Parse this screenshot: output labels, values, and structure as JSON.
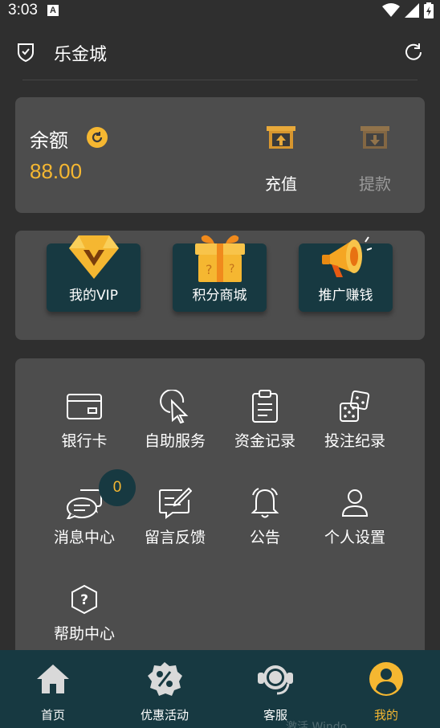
{
  "status_bar": {
    "time": "3:03",
    "notification_icon": "A"
  },
  "header": {
    "title": "乐金城"
  },
  "balance": {
    "label": "余额",
    "value": "88.00",
    "deposit_label": "充值",
    "withdraw_label": "提款"
  },
  "promos": [
    {
      "label": "我的VIP",
      "icon": "vip-diamond-icon"
    },
    {
      "label": "积分商城",
      "icon": "gift-box-icon"
    },
    {
      "label": "推广赚钱",
      "icon": "megaphone-icon"
    }
  ],
  "menu": [
    {
      "label": "银行卡",
      "icon": "bank-card-icon"
    },
    {
      "label": "自助服务",
      "icon": "pointer-hand-icon"
    },
    {
      "label": "资金记录",
      "icon": "clipboard-icon"
    },
    {
      "label": "投注纪录",
      "icon": "dice-icon"
    },
    {
      "label": "消息中心",
      "icon": "chat-bubbles-icon"
    },
    {
      "label": "留言反馈",
      "icon": "feedback-edit-icon"
    },
    {
      "label": "公告",
      "icon": "bell-icon"
    },
    {
      "label": "个人设置",
      "icon": "user-icon"
    },
    {
      "label": "帮助中心",
      "icon": "help-icon"
    }
  ],
  "message_badge": "0",
  "bottom_nav": [
    {
      "label": "首页",
      "icon": "home-icon"
    },
    {
      "label": "优惠活动",
      "icon": "percent-badge-icon"
    },
    {
      "label": "客服",
      "icon": "headset-icon"
    },
    {
      "label": "我的",
      "icon": "profile-icon"
    }
  ],
  "watermark": "激活 Windo",
  "colors": {
    "background": "#2f2f2f",
    "card": "#4d4d4d",
    "accent": "#f5b731",
    "dark_teal": "#173941",
    "muted": "#9a9a9a"
  }
}
